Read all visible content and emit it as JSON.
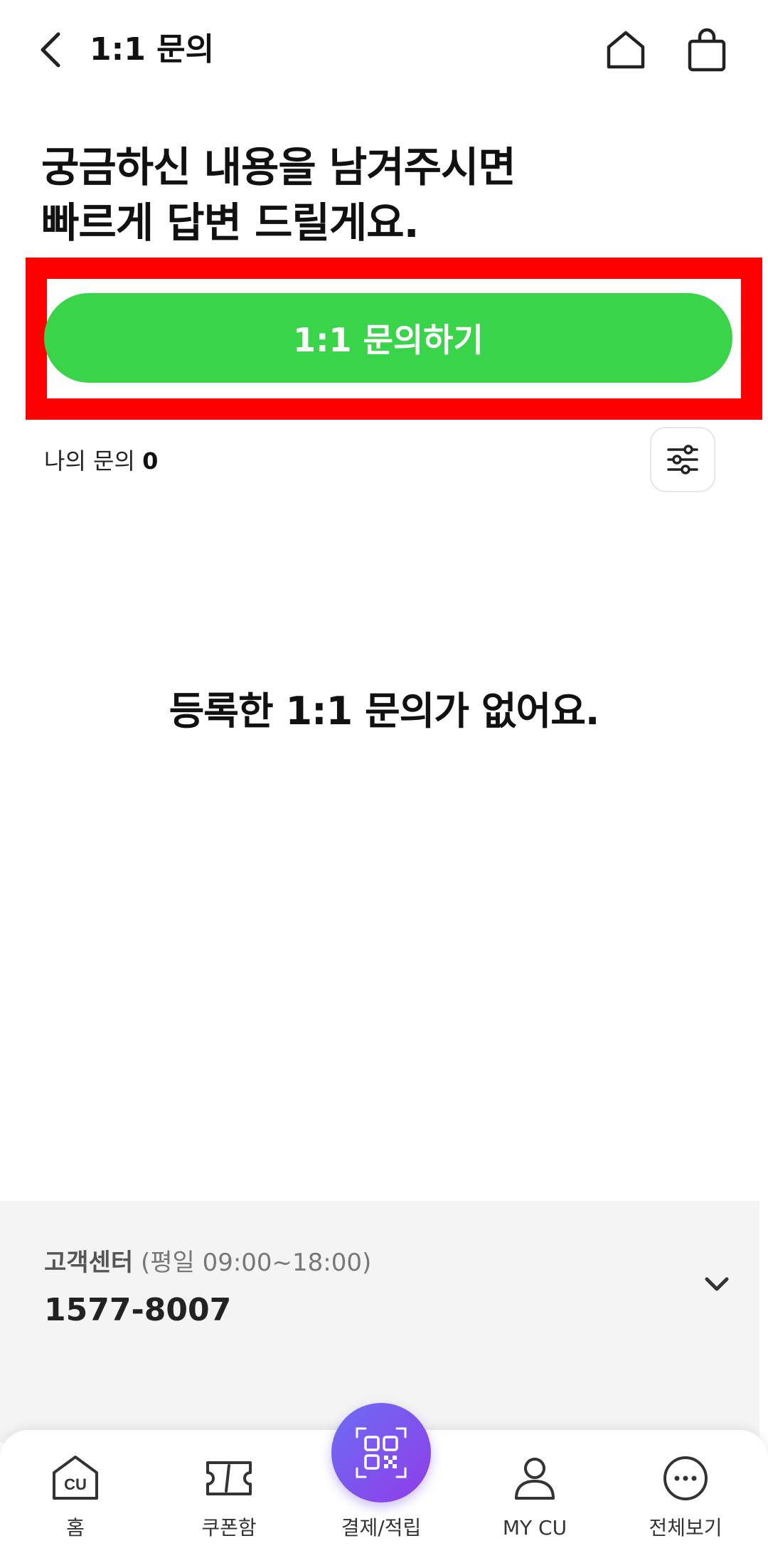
{
  "header": {
    "title": "1:1 문의",
    "back_icon": "chevron-left-icon",
    "home_icon": "home-icon",
    "cart_icon": "shopping-bag-icon"
  },
  "headline": {
    "line1": "궁금하신 내용을 남겨주시면",
    "line2": "빠르게 답변 드릴게요."
  },
  "inquiry_button": {
    "label": "1:1 문의하기",
    "color": "#3ad44a"
  },
  "my_inquiry": {
    "label": "나의 문의",
    "count": "0",
    "filter_icon": "sliders-icon"
  },
  "empty_message": "등록한 1:1 문의가 없어요.",
  "customer_center": {
    "label": "고객센터",
    "hours": "(평일 09:00~18:00)",
    "phone": "1577-8007",
    "toggle_icon": "chevron-down-icon"
  },
  "bottom_nav": {
    "items": [
      {
        "label": "홈",
        "icon": "cu-home-icon"
      },
      {
        "label": "쿠폰함",
        "icon": "ticket-icon"
      },
      {
        "label": "결제/적립",
        "icon": "qr-code-icon"
      },
      {
        "label": "MY CU",
        "icon": "user-icon"
      },
      {
        "label": "전체보기",
        "icon": "more-icon"
      }
    ]
  },
  "colors": {
    "accent_green": "#3ad44a",
    "highlight_red": "#ff0000",
    "pay_gradient_start": "#6d6cf4",
    "pay_gradient_end": "#8f3de8"
  }
}
